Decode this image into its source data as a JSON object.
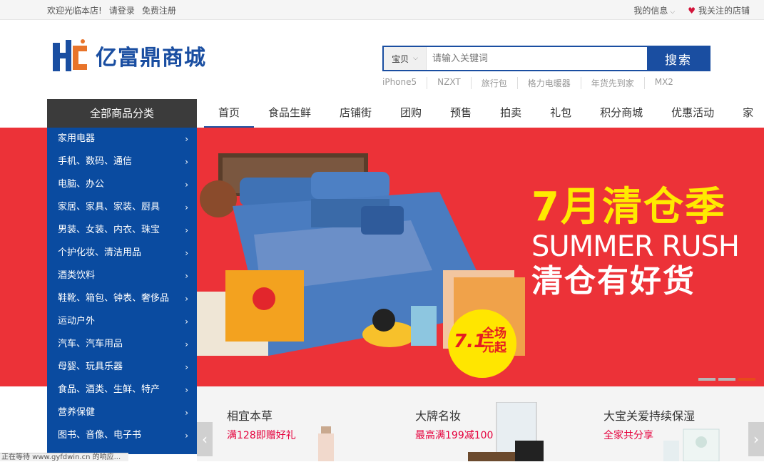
{
  "topbar": {
    "welcome": "欢迎光临本店!",
    "login": "请登录",
    "register": "免费注册",
    "my_info": "我的信息",
    "followed_shops": "我关注的店铺"
  },
  "logo": {
    "name": "亿富鼎商城"
  },
  "search": {
    "scope": "宝贝",
    "placeholder": "请输入关键词",
    "button": "搜索",
    "hotwords": [
      "iPhone5",
      "NZXT",
      "旅行包",
      "格力电暖器",
      "年货先到家",
      "MX2"
    ]
  },
  "nav": {
    "category_button": "全部商品分类",
    "links": [
      "首页",
      "食品生鲜",
      "店铺街",
      "团购",
      "预售",
      "拍卖",
      "礼包",
      "积分商城",
      "优惠活动",
      "家"
    ]
  },
  "categories": [
    "家用电器",
    "手机、数码、通信",
    "电脑、办公",
    "家居、家具、家装、厨具",
    "男装、女装、内衣、珠宝",
    "个护化妆、清洁用品",
    "酒类饮料",
    "鞋靴、箱包、钟表、奢侈品",
    "运动户外",
    "汽车、汽车用品",
    "母婴、玩具乐器",
    "食品、酒类、生鲜、特产",
    "营养保健",
    "图书、音像、电子书"
  ],
  "banner": {
    "headline": "7月清仓季",
    "english": "SUMMER RUSH",
    "subline": "清仓有好货",
    "badge_num": "7.1",
    "badge_text_1": "全场",
    "badge_text_2": "元起",
    "colors": {
      "bg": "#ec3238",
      "headline": "#ffea00",
      "badge": "#ffe600"
    }
  },
  "promos": [
    {
      "title": "相宜本草",
      "subtitle": "满128即赠好礼"
    },
    {
      "title": "大牌名妆",
      "subtitle": "最高满199减100"
    },
    {
      "title": "大宝关爱持续保湿",
      "subtitle": "全家共分享"
    }
  ],
  "status_text": "正在等待 www.gyfdwin.cn 的响应..."
}
